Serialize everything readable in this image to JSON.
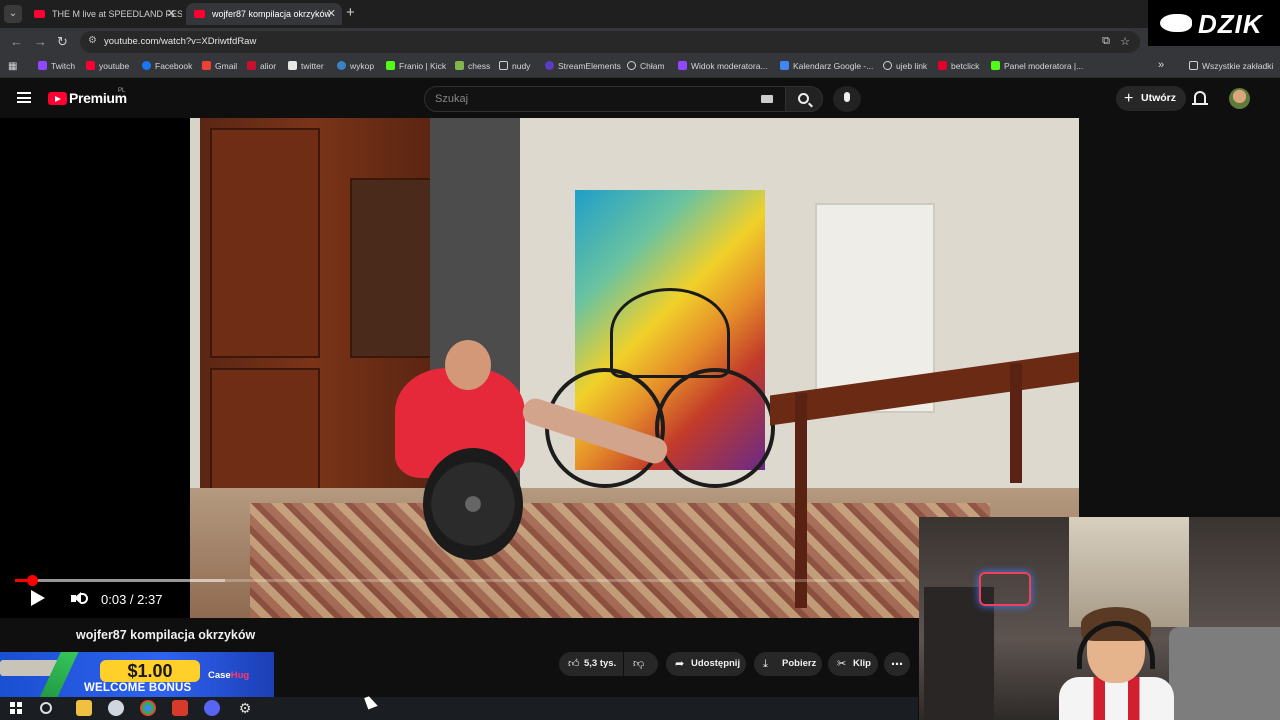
{
  "browser": {
    "tabs": [
      {
        "label": "THE M live at SPEEDLAND FEST",
        "active": false
      },
      {
        "label": "wojfer87 kompilacja okrzyków",
        "active": true
      }
    ],
    "new_tab": "+",
    "close": "✕",
    "url": "youtube.com/watch?v=XDriwtfdRaw",
    "bookmarks": [
      {
        "label": "Twitch",
        "color": "#9146ff"
      },
      {
        "label": "youtube",
        "color": "#ff0033"
      },
      {
        "label": "Facebook",
        "color": "#1877f2"
      },
      {
        "label": "Gmail",
        "color": "#ea4335"
      },
      {
        "label": "alior",
        "color": "#c8102e"
      },
      {
        "label": "twitter",
        "color": "#e7e7e7"
      },
      {
        "label": "wykop",
        "color": "#3b82c4"
      },
      {
        "label": "Franio | Kick",
        "color": "#53fc18"
      },
      {
        "label": "chess",
        "color": "#81b64c"
      },
      {
        "label": "nudy",
        "color": "#cfcfcf"
      },
      {
        "label": "StreamElements",
        "color": "#5b3cc4"
      },
      {
        "label": "Chłam",
        "color": "#cfcfcf"
      },
      {
        "label": "Widok moderatora...",
        "color": "#9146ff"
      },
      {
        "label": "Kalendarz Google -...",
        "color": "#4285f4"
      },
      {
        "label": "ujeb link",
        "color": "#cfcfcf"
      },
      {
        "label": "betclick",
        "color": "#e4002b"
      },
      {
        "label": "Panel moderatora |...",
        "color": "#53fc18"
      }
    ],
    "all_bookmarks": "Wszystkie zakładki",
    "more_bookmarks": "»"
  },
  "overlay": {
    "brand": "DZIK"
  },
  "youtube": {
    "logo_text": "Premium",
    "country": "PL",
    "search_placeholder": "Szukaj",
    "create_label": "Utwórz",
    "create_icon": "+"
  },
  "player": {
    "current_time": "0:03",
    "duration": "2:37",
    "time_display": "0:03 / 2:37",
    "progress_fraction": 0.019,
    "buffered_fraction": 0.236
  },
  "video": {
    "title": "wojfer87 kompilacja okrzyków",
    "likes": "5,3 tys.",
    "share_label": "Udostępnij",
    "download_label": "Pobierz",
    "clip_label": "Klip",
    "more_label": "⋯"
  },
  "ad": {
    "amount": "$1.00",
    "bonus": "WELCOME BONUS",
    "brand_a": "Case",
    "brand_b": "Hug"
  },
  "colors": {
    "youtube_red": "#ff0033",
    "progress_red": "#ff0000",
    "background": "#0f0f0f"
  }
}
